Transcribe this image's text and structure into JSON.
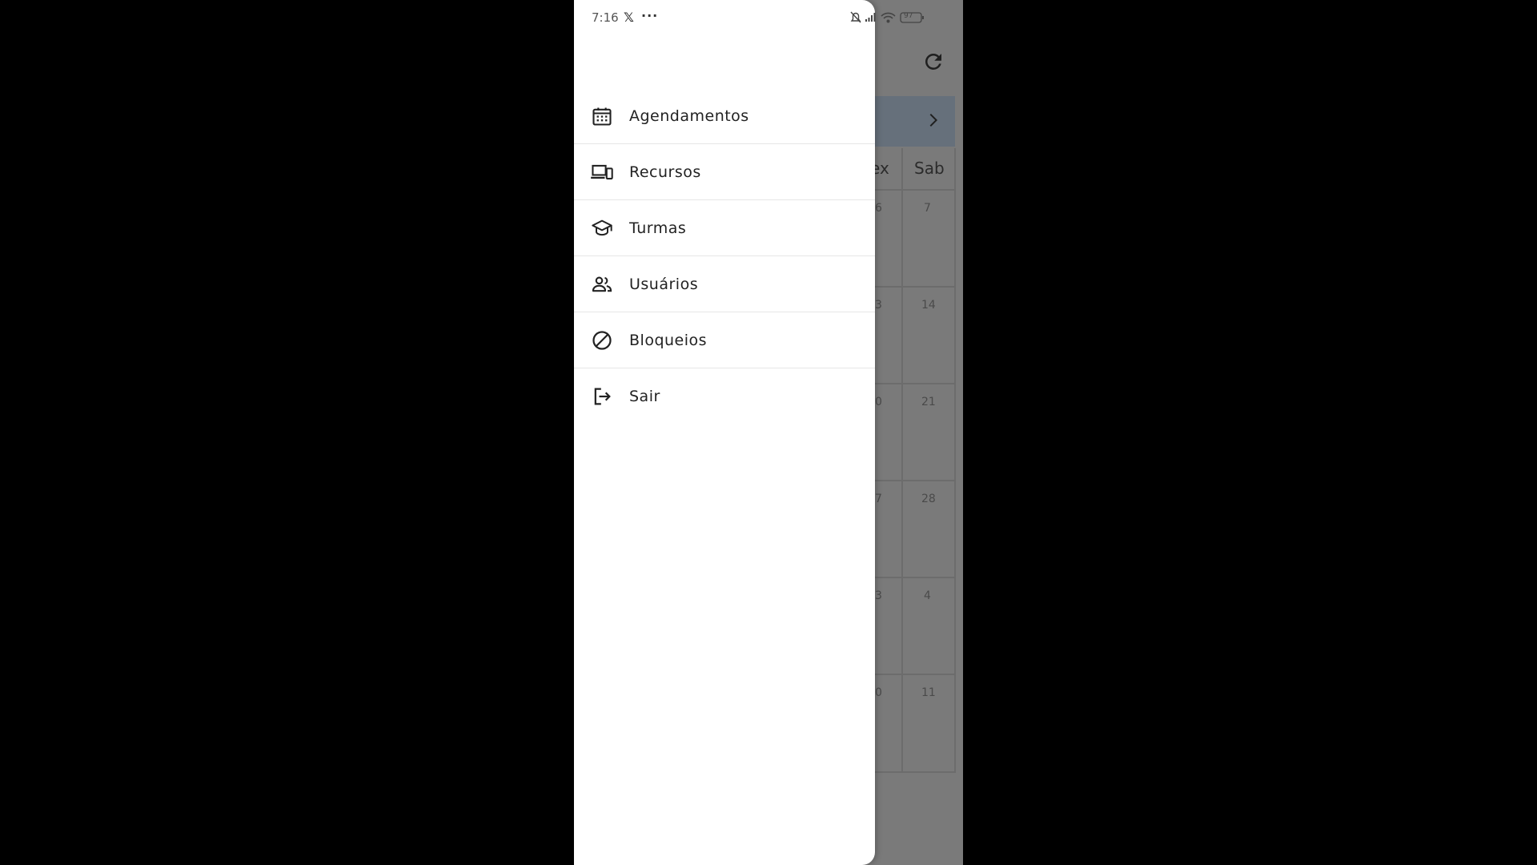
{
  "status_bar": {
    "time": "7:16",
    "x_app": "𝕏",
    "more": "···",
    "battery": "97"
  },
  "background_calendar": {
    "day_headers": [
      "ex",
      "Sab"
    ],
    "dates_col_partial": [
      "6",
      "3",
      "0",
      "7",
      "3",
      "0"
    ],
    "dates_sab": [
      "7",
      "14",
      "21",
      "28",
      "4",
      "11"
    ]
  },
  "drawer": {
    "items": [
      {
        "label": "Agendamentos",
        "icon": "calendar-icon"
      },
      {
        "label": "Recursos",
        "icon": "devices-icon"
      },
      {
        "label": "Turmas",
        "icon": "graduation-cap-icon"
      },
      {
        "label": "Usuários",
        "icon": "people-icon"
      },
      {
        "label": "Bloqueios",
        "icon": "block-icon"
      },
      {
        "label": "Sair",
        "icon": "logout-icon"
      }
    ]
  },
  "colors": {
    "drawer_bg": "#ffffff",
    "scrim": "#7a7a7a",
    "header_dim": "#66707b",
    "text": "#222222"
  }
}
